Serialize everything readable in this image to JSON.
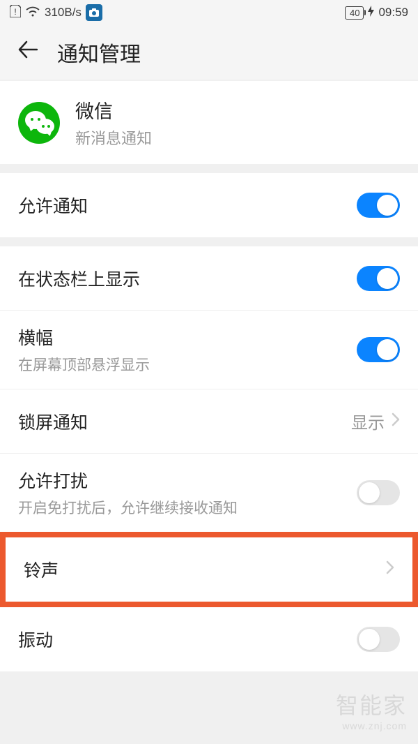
{
  "status_bar": {
    "speed": "310B/s",
    "battery_level": "40",
    "time": "09:59"
  },
  "header": {
    "title": "通知管理"
  },
  "app": {
    "name": "微信",
    "subtitle": "新消息通知"
  },
  "settings": {
    "allow_notify": {
      "label": "允许通知",
      "on": true
    },
    "status_bar_show": {
      "label": "在状态栏上显示",
      "on": true
    },
    "banner": {
      "label": "横幅",
      "sub": "在屏幕顶部悬浮显示",
      "on": true
    },
    "lockscreen": {
      "label": "锁屏通知",
      "value": "显示"
    },
    "allow_disturb": {
      "label": "允许打扰",
      "sub": "开启免打扰后，允许继续接收通知",
      "on": false
    },
    "ringtone": {
      "label": "铃声"
    },
    "vibrate": {
      "label": "振动",
      "on": false
    }
  },
  "watermark": {
    "main": "智能家",
    "sub": "www.znj.com"
  }
}
